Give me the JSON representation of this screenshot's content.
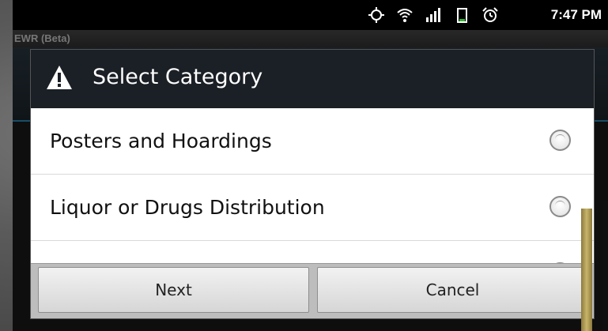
{
  "status_bar": {
    "time": "7:47 PM",
    "icons": [
      "gps-icon",
      "wifi-icon",
      "signal-icon",
      "battery-icon",
      "alarm-icon"
    ]
  },
  "app": {
    "title": "EWR (Beta)"
  },
  "dialog": {
    "title": "Select Category",
    "icon": "warning-icon",
    "items": [
      {
        "label": "Posters and Hoardings",
        "selected": false
      },
      {
        "label": "Liquor or Drugs Distribution",
        "selected": false
      }
    ],
    "buttons": {
      "next": "Next",
      "cancel": "Cancel"
    }
  },
  "colors": {
    "dialog_header": "#1b1f26",
    "app_accent_line": "#2f8fb8"
  }
}
